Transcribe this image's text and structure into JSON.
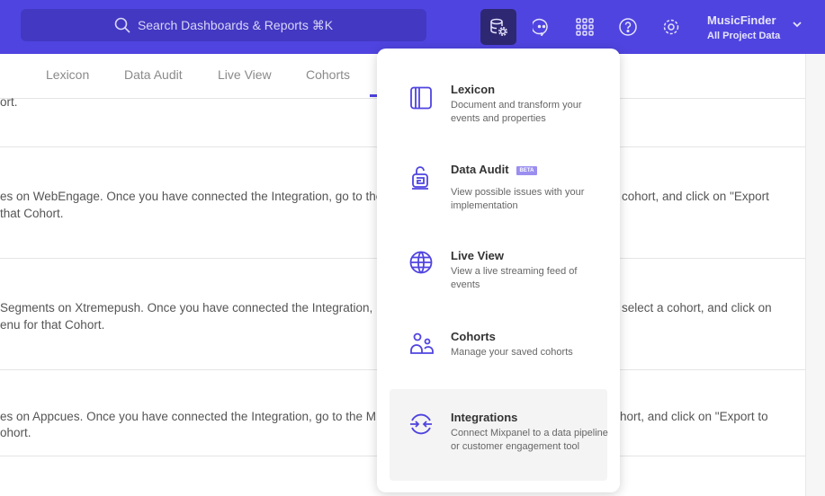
{
  "topbar": {
    "search_placeholder": "Search Dashboards & Reports ⌘K",
    "project_name": "MusicFinder",
    "project_scope": "All Project Data",
    "icons": [
      "data-management-icon",
      "chat-icon",
      "apps-grid-icon",
      "help-icon",
      "settings-icon"
    ]
  },
  "tabs": [
    {
      "label": "Lexicon"
    },
    {
      "label": "Data Audit"
    },
    {
      "label": "Live View"
    },
    {
      "label": "Cohorts"
    }
  ],
  "rows": [
    {
      "left": [
        "ort."
      ],
      "right": []
    },
    {
      "left": [
        "es on WebEngage. Once you have connected the Integration, go to the",
        "that Cohort."
      ],
      "right": [
        "cohort, and click on \"Export"
      ]
    },
    {
      "left": [
        "Segments on Xtremepush. Once you have connected the Integration,",
        "enu for that Cohort."
      ],
      "right": [
        "select a cohort, and click on"
      ]
    },
    {
      "left": [
        "es on Appcues. Once you have connected the Integration, go to the M",
        "ohort."
      ],
      "right": [
        "hort, and click on \"Export to"
      ]
    }
  ],
  "menu": {
    "items": [
      {
        "title": "Lexicon",
        "desc": "Document and transform your events and properties",
        "icon": "lexicon-book-icon"
      },
      {
        "title": "Data Audit",
        "badge": "BETA",
        "desc": "View possible issues with your implementation",
        "icon": "data-audit-icon"
      },
      {
        "title": "Live View",
        "desc": "View a live streaming feed of events",
        "icon": "globe-icon"
      },
      {
        "title": "Cohorts",
        "desc": "Manage your saved cohorts",
        "icon": "people-icon"
      },
      {
        "title": "Integrations",
        "desc": "Connect Mixpanel to a data pipeline or customer engagement tool",
        "icon": "integrations-icon",
        "highlighted": true
      }
    ]
  },
  "colors": {
    "brand": "#4f44e0",
    "icon": "#4f44e0"
  }
}
